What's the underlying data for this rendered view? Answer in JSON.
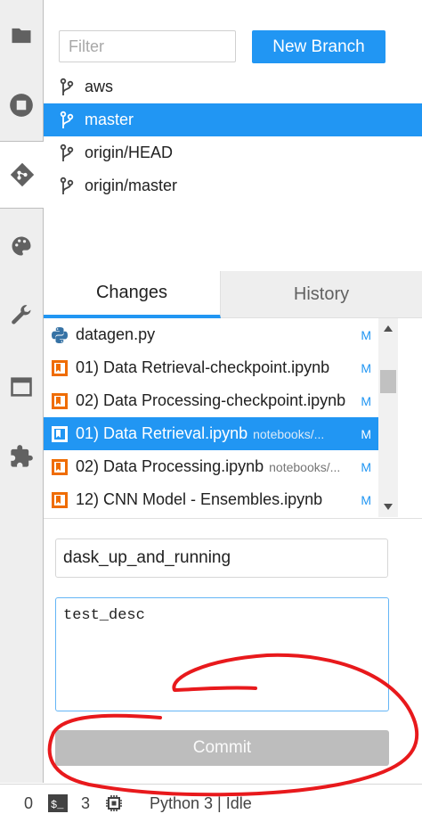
{
  "sidebar": {
    "icons": [
      "folder-icon",
      "running-stop-icon",
      "git-icon",
      "palette-icon",
      "wrench-icon",
      "tab-window-icon",
      "extension-puzzle-icon"
    ],
    "active": "git-icon"
  },
  "git_panel": {
    "filter_placeholder": "Filter",
    "new_branch_label": "New Branch",
    "branches": [
      {
        "name": "aws",
        "selected": false
      },
      {
        "name": "master",
        "selected": true
      },
      {
        "name": "origin/HEAD",
        "selected": false
      },
      {
        "name": "origin/master",
        "selected": false
      }
    ],
    "tabs": [
      {
        "label": "Changes",
        "active": true
      },
      {
        "label": "History",
        "active": false
      }
    ],
    "files": [
      {
        "name": "datagen.py",
        "path": "",
        "status": "M",
        "icon": "python-file-icon",
        "selected": false
      },
      {
        "name": "01) Data Retrieval-checkpoint.ipynb",
        "path": "",
        "status": "M",
        "icon": "notebook-icon",
        "selected": false
      },
      {
        "name": "02) Data Processing-checkpoint.ipynb",
        "path": "",
        "status": "M",
        "icon": "notebook-icon",
        "selected": false
      },
      {
        "name": "01) Data Retrieval.ipynb",
        "path": "notebooks/...",
        "status": "M",
        "icon": "notebook-icon",
        "selected": true
      },
      {
        "name": "02) Data Processing.ipynb",
        "path": "notebooks/...",
        "status": "M",
        "icon": "notebook-icon",
        "selected": false
      },
      {
        "name": "12) CNN Model - Ensembles.ipynb",
        "path": "",
        "status": "M",
        "icon": "notebook-icon",
        "selected": false
      }
    ],
    "commit_summary_value": "dask_up_and_running",
    "commit_description_value": "test_desc",
    "commit_label": "Commit"
  },
  "status_bar": {
    "first_count": "0",
    "terminal_count": "3",
    "kernel_status": "Python 3 | Idle"
  },
  "colors": {
    "accent": "#2196f3",
    "annotation": "#e8191c"
  }
}
